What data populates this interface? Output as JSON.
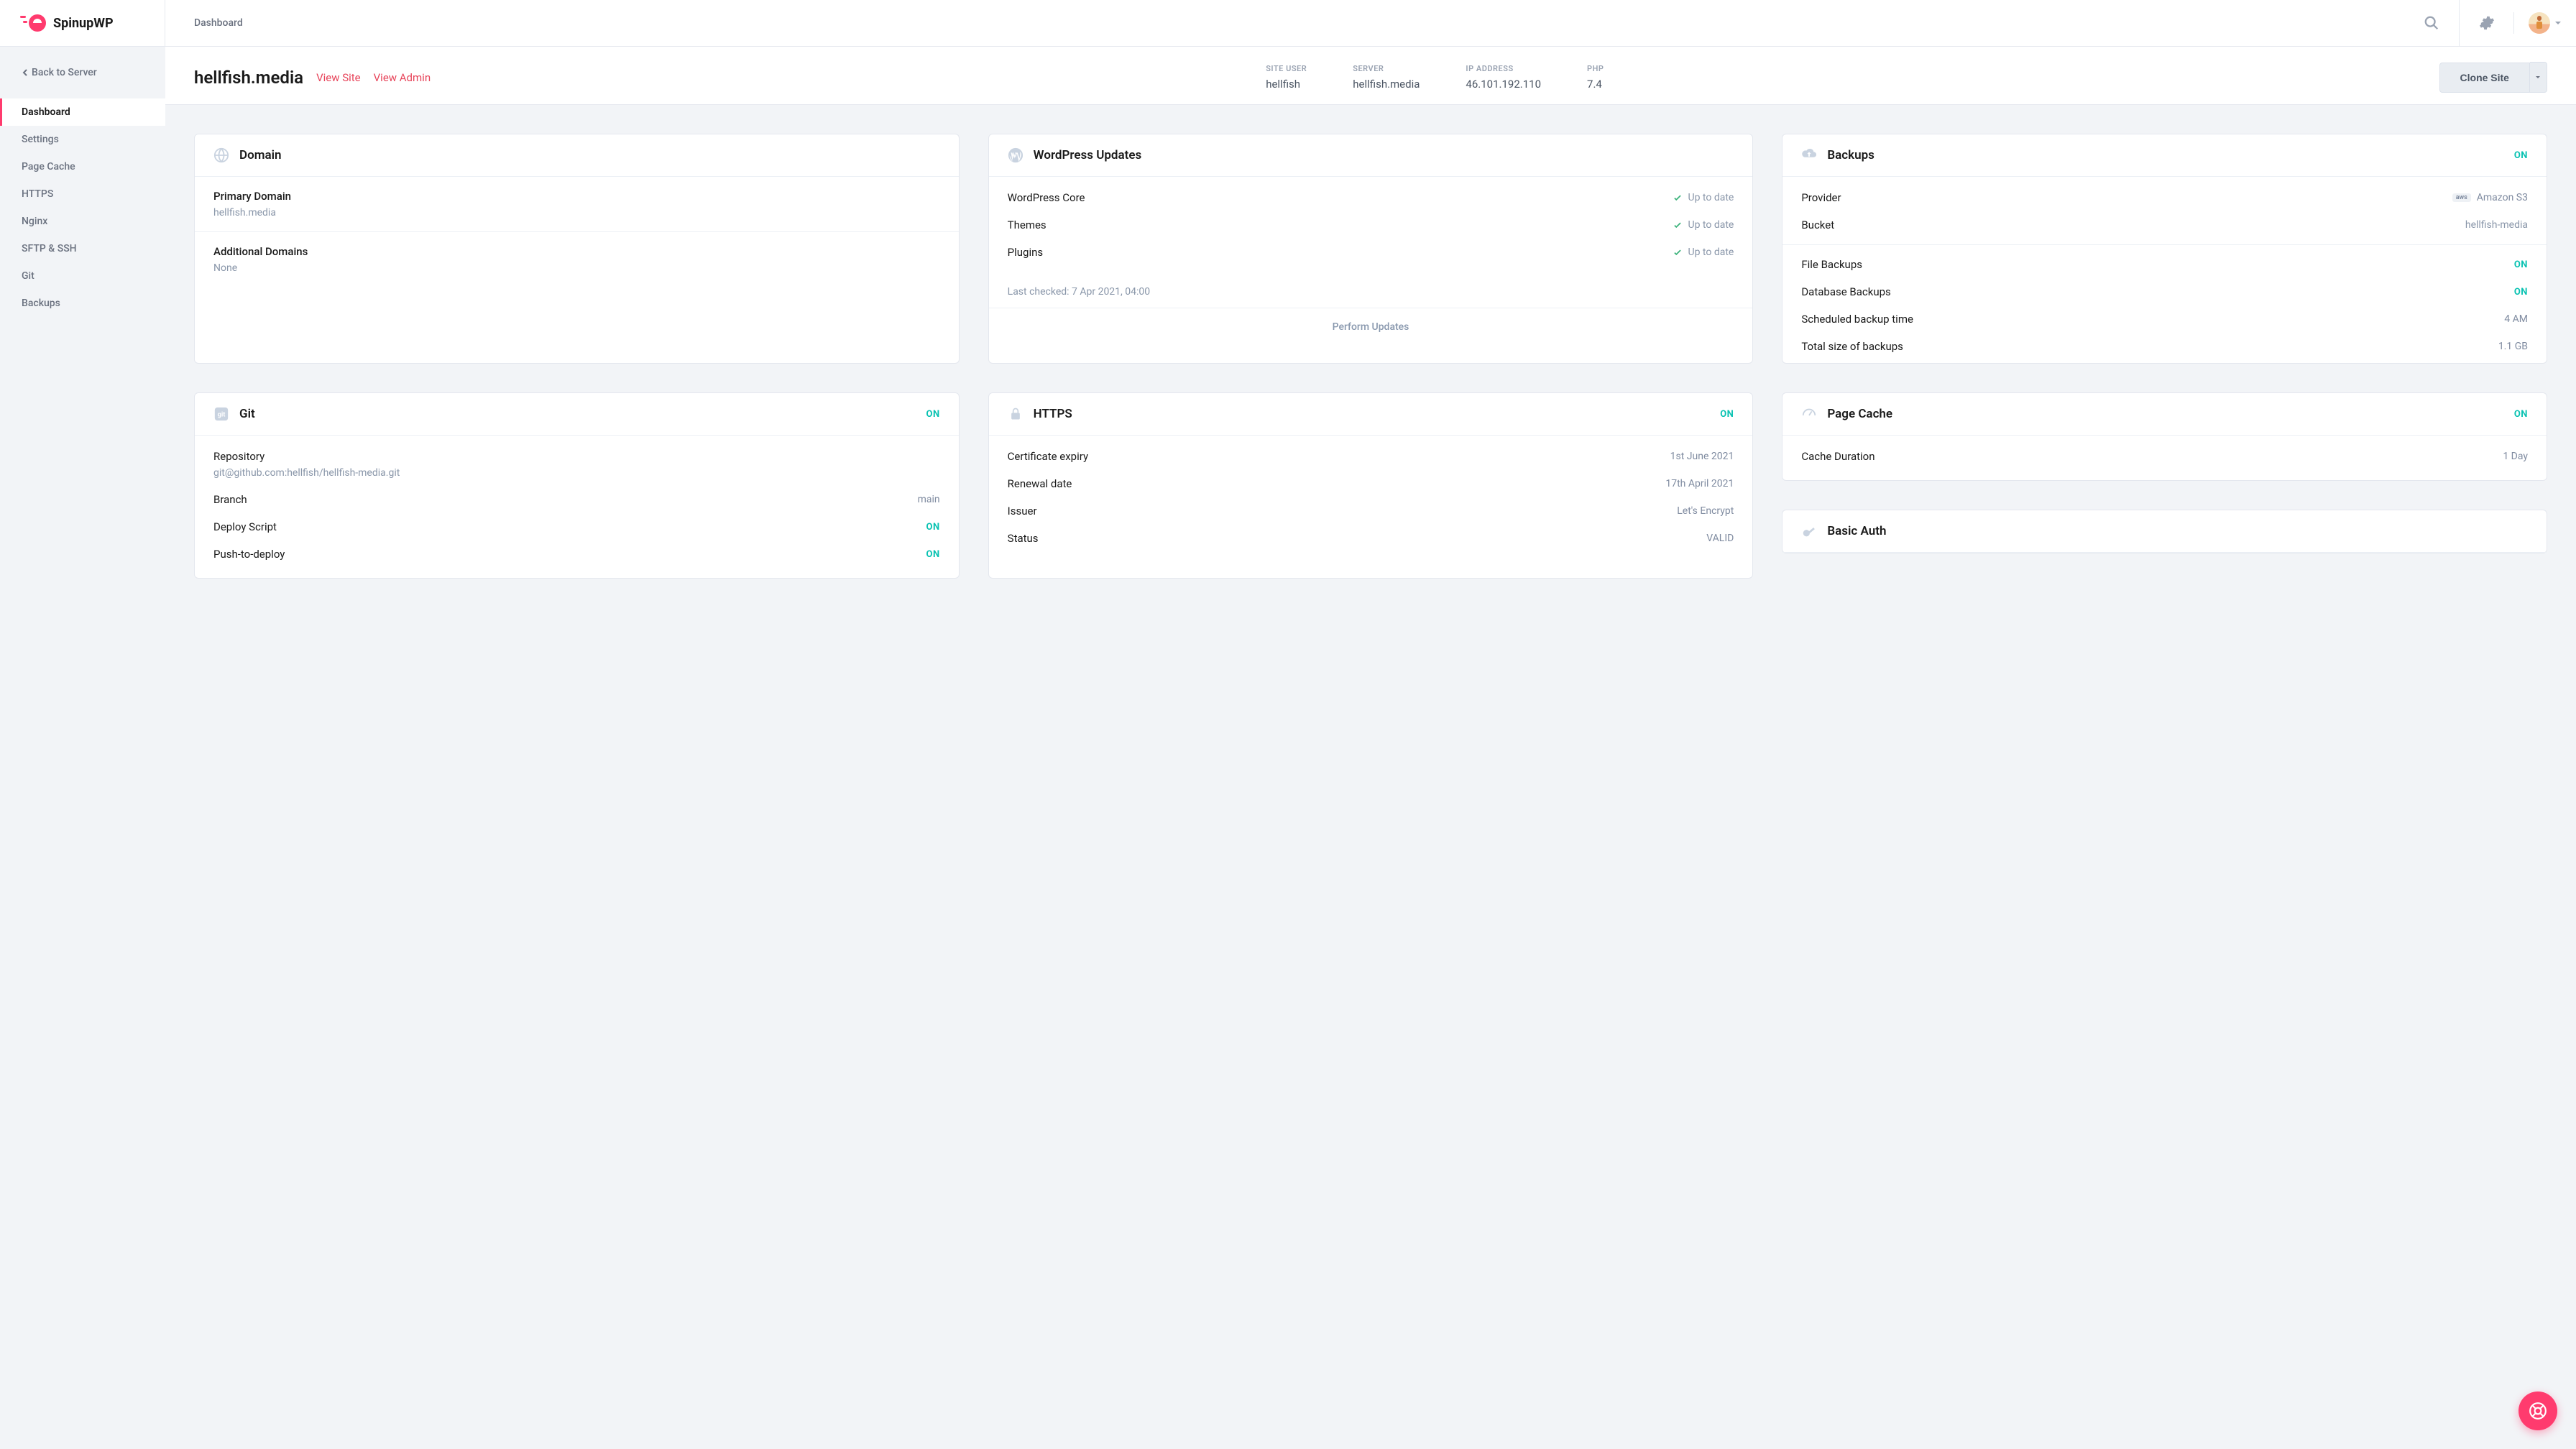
{
  "brand": "SpinupWP",
  "topbar": {
    "breadcrumb": "Dashboard"
  },
  "sidebar": {
    "back_label": "Back to Server",
    "items": [
      {
        "label": "Dashboard",
        "active": true
      },
      {
        "label": "Settings"
      },
      {
        "label": "Page Cache"
      },
      {
        "label": "HTTPS"
      },
      {
        "label": "Nginx"
      },
      {
        "label": "SFTP & SSH"
      },
      {
        "label": "Git"
      },
      {
        "label": "Backups"
      }
    ]
  },
  "header": {
    "site_title": "hellfish.media",
    "view_site": "View Site",
    "view_admin": "View Admin",
    "meta": {
      "site_user_label": "SITE USER",
      "site_user_value": "hellfish",
      "server_label": "SERVER",
      "server_value": "hellfish.media",
      "ip_label": "IP ADDRESS",
      "ip_value": "46.101.192.110",
      "php_label": "PHP",
      "php_value": "7.4"
    },
    "clone_button": "Clone Site"
  },
  "status": {
    "on": "ON"
  },
  "cards": {
    "domain": {
      "title": "Domain",
      "primary_label": "Primary Domain",
      "primary_value": "hellfish.media",
      "additional_label": "Additional Domains",
      "additional_value": "None"
    },
    "wp_updates": {
      "title": "WordPress Updates",
      "items": [
        {
          "label": "WordPress Core",
          "status": "Up to date"
        },
        {
          "label": "Themes",
          "status": "Up to date"
        },
        {
          "label": "Plugins",
          "status": "Up to date"
        }
      ],
      "last_checked": "Last checked: 7 Apr 2021, 04:00",
      "perform": "Perform Updates"
    },
    "backups": {
      "title": "Backups",
      "provider_label": "Provider",
      "provider_value": "Amazon S3",
      "bucket_label": "Bucket",
      "bucket_value": "hellfish-media",
      "file_backups_label": "File Backups",
      "file_backups_value": "ON",
      "db_backups_label": "Database Backups",
      "db_backups_value": "ON",
      "schedule_label": "Scheduled backup time",
      "schedule_value": "4 AM",
      "size_label": "Total size of backups",
      "size_value": "1.1 GB"
    },
    "git": {
      "title": "Git",
      "repo_label": "Repository",
      "repo_value": "git@github.com:hellfish/hellfish-media.git",
      "branch_label": "Branch",
      "branch_value": "main",
      "deploy_label": "Deploy Script",
      "deploy_value": "ON",
      "push_label": "Push-to-deploy",
      "push_value": "ON"
    },
    "https": {
      "title": "HTTPS",
      "expiry_label": "Certificate expiry",
      "expiry_value": "1st June 2021",
      "renewal_label": "Renewal date",
      "renewal_value": "17th April 2021",
      "issuer_label": "Issuer",
      "issuer_value": "Let's Encrypt",
      "status_label": "Status",
      "status_value": "VALID"
    },
    "page_cache": {
      "title": "Page Cache",
      "duration_label": "Cache Duration",
      "duration_value": "1 Day"
    },
    "basic_auth": {
      "title": "Basic Auth"
    }
  }
}
